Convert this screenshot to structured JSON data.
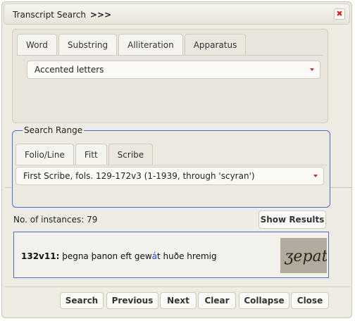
{
  "dialog": {
    "title": "Transcript Search",
    "title_extra": ">>>",
    "close_label": "✖"
  },
  "search_tabs": [
    {
      "label": "Word",
      "active": false
    },
    {
      "label": "Substring",
      "active": false
    },
    {
      "label": "Alliteration",
      "active": false
    },
    {
      "label": "Apparatus",
      "active": true
    }
  ],
  "apparatus_select": {
    "value": "Accented letters"
  },
  "search_range": {
    "legend": "Search Range",
    "tabs": [
      {
        "label": "Folio/Line",
        "active": false
      },
      {
        "label": "Fitt",
        "active": false
      },
      {
        "label": "Scribe",
        "active": true
      }
    ],
    "select_value": "First Scribe, fols. 129-172v3 (1-1939, through 'scyran')"
  },
  "instances": {
    "label": "No. of instances: 79",
    "show_results_label": "Show Results"
  },
  "result": {
    "folio": "132v11:",
    "text_before": "þegna þanon eft gew",
    "highlight": "á",
    "text_after": "t huðe hremig",
    "manuscript_word": "ʒepat"
  },
  "buttons": {
    "search": "Search",
    "previous": "Previous",
    "next": "Next",
    "clear": "Clear",
    "collapse": "Collapse",
    "close": "Close"
  },
  "colors": {
    "accent_border": "#4a6fd0",
    "highlight": "#2244cc",
    "caret": "#cc3333"
  }
}
